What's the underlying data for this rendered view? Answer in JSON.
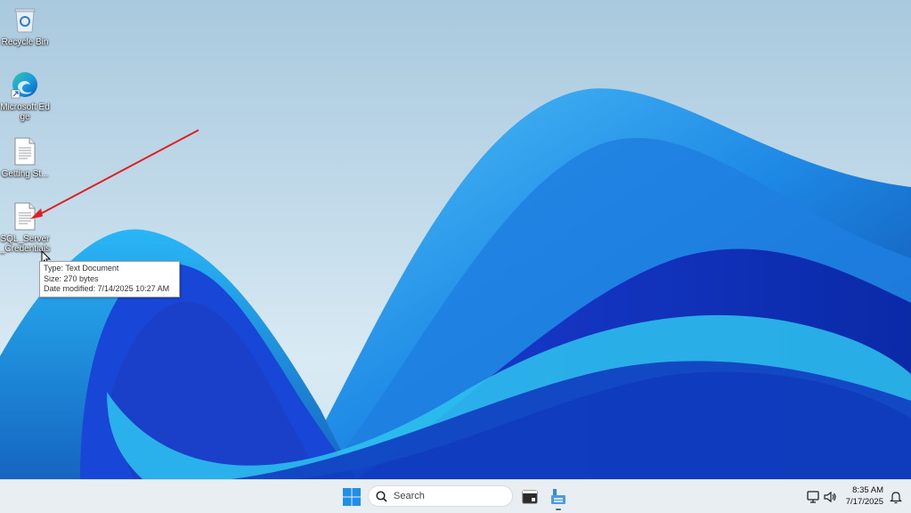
{
  "desktop": {
    "icons": [
      {
        "label": "Recycle Bin",
        "icon": "recycle-bin-icon"
      },
      {
        "label": "Microsoft Edge",
        "icon": "edge-icon"
      },
      {
        "label": "Getting St...",
        "icon": "text-file-icon"
      },
      {
        "label": "SQL_Server_Credentials",
        "icon": "text-file-icon"
      }
    ],
    "tooltip": {
      "type": "Type: Text Document",
      "size": "Size: 270 bytes",
      "modified": "Date modified: 7/14/2025 10:27 AM"
    },
    "annotation_color": "#e02020"
  },
  "taskbar": {
    "search_placeholder": "Search",
    "apps": [
      {
        "name": "Terminal",
        "icon": "terminal-icon"
      },
      {
        "name": "File Explorer",
        "icon": "file-explorer-icon"
      }
    ],
    "tray": {
      "time": "8:35 AM",
      "date": "7/17/2025"
    },
    "accent": "#0f6cbd"
  }
}
